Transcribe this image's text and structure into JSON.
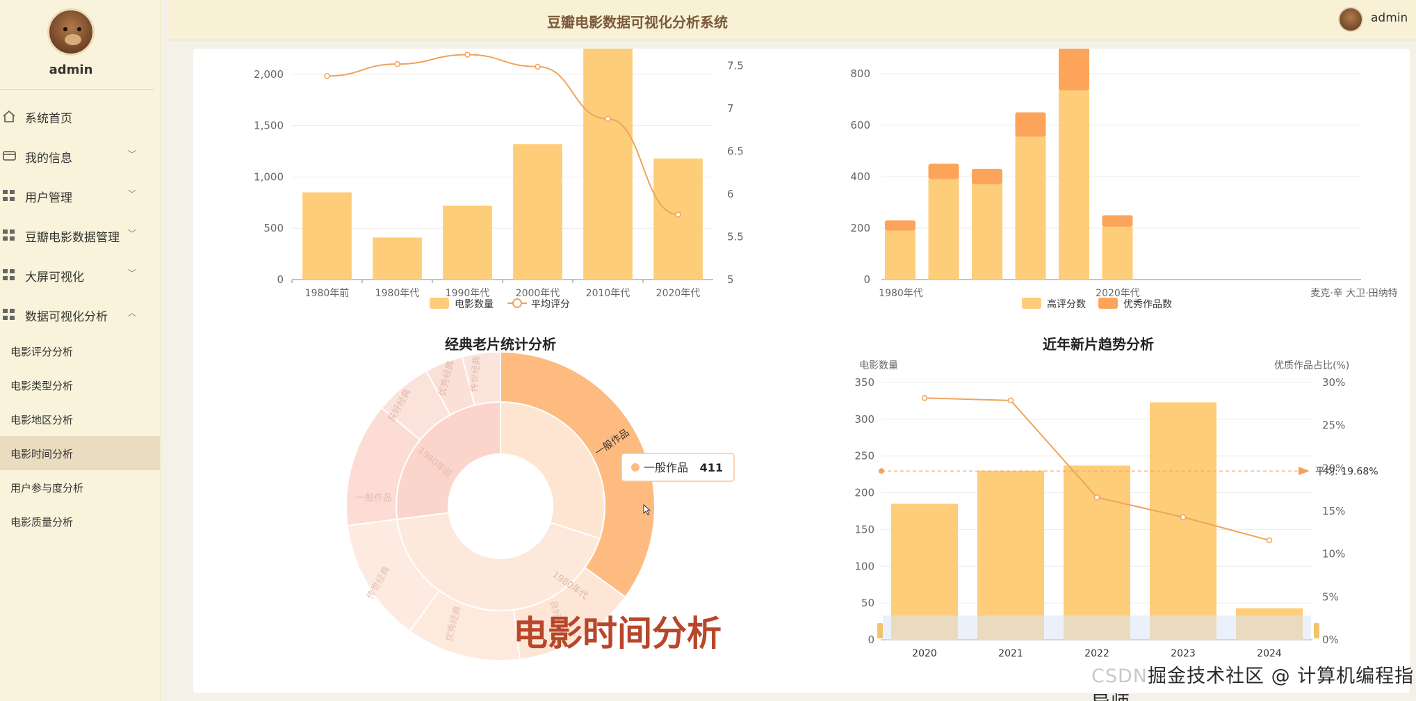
{
  "sidebar": {
    "username": "admin",
    "menu": [
      {
        "label": "系统首页",
        "icon": "home-icon",
        "caret": ""
      },
      {
        "label": "我的信息",
        "icon": "card-icon",
        "caret": "﹀"
      },
      {
        "label": "用户管理",
        "icon": "grid-icon",
        "caret": "﹀"
      },
      {
        "label": "豆瓣电影数据管理",
        "icon": "grid-icon",
        "caret": "﹀"
      },
      {
        "label": "大屏可视化",
        "icon": "grid-icon",
        "caret": "﹀"
      },
      {
        "label": "数据可视化分析",
        "icon": "grid-icon",
        "caret": "︿"
      }
    ],
    "submenu": [
      "电影评分分析",
      "电影类型分析",
      "电影地区分析",
      "电影时间分析",
      "用户参与度分析",
      "电影质量分析"
    ],
    "active_sub": "电影时间分析"
  },
  "header": {
    "title": "豆瓣电影数据可视化分析系统",
    "username": "admin"
  },
  "chart_data": [
    {
      "type": "bar",
      "categories": [
        "1980年前",
        "1980年代",
        "1990年代",
        "2000年代",
        "2010年代",
        "2020年代"
      ],
      "series": [
        {
          "name": "电影数量",
          "type": "bar",
          "values": [
            850,
            410,
            720,
            1320,
            2250,
            1180
          ]
        },
        {
          "name": "平均评分",
          "type": "line",
          "axis": "right",
          "values": [
            7.38,
            7.52,
            7.63,
            7.49,
            6.88,
            5.76
          ]
        }
      ],
      "y_left_ticks": [
        "0",
        "500",
        "1,000",
        "1,500",
        "2,000"
      ],
      "y_left_range": [
        0,
        2250
      ],
      "y_right_ticks": [
        "5",
        "5.5",
        "6",
        "6.5",
        "7",
        "7.5"
      ],
      "y_right_range": [
        5,
        7.7
      ],
      "colors": {
        "bar": "#fdcd7a",
        "line": "#f0a35a"
      }
    },
    {
      "type": "bar",
      "stacked": true,
      "categories": [
        "1980年代",
        "",
        "",
        "",
        "",
        "2020年代",
        "",
        "",
        "",
        "",
        "麦克·辛 大卫·田纳特"
      ],
      "series": [
        {
          "name": "高评分数",
          "values": [
            190,
            390,
            370,
            555,
            735,
            205
          ]
        },
        {
          "name": "优秀作品数",
          "values": [
            40,
            60,
            60,
            95,
            165,
            45
          ]
        }
      ],
      "y_ticks": [
        "0",
        "200",
        "400",
        "600",
        "800"
      ],
      "y_range": [
        0,
        900
      ],
      "colors": {
        "high": "#fdcd7a",
        "excellent": "#fca55a"
      }
    },
    {
      "type": "sunburst",
      "title": "经典老片统计分析",
      "inner": [
        {
          "label": "1980年前",
          "value": 0.27
        },
        {
          "label": "1980年代",
          "value": 0.73
        }
      ],
      "outer": [
        {
          "label": "一般作品",
          "value": 0.222
        },
        {
          "label": "良好经典",
          "value": 0.111
        },
        {
          "label": "传世经典",
          "value": 0.111
        },
        {
          "label": "优秀经典",
          "value": 0.111
        },
        {
          "label": "良好经典",
          "value": 0.111
        },
        {
          "label": "一般作品",
          "value": 0.167
        },
        {
          "label": "良好经典",
          "value": 0.055
        },
        {
          "label": "优秀经典",
          "value": 0.056
        },
        {
          "label": "传世经典",
          "value": 0.056
        }
      ],
      "tooltip": {
        "label": "一般作品",
        "value": "411"
      },
      "colors": {
        "highlight": "#fdbb80",
        "inner_main": "#fde3cc",
        "pale": "#fdeee3"
      }
    },
    {
      "type": "bar",
      "title": "近年新片趋势分析",
      "categories": [
        "2020",
        "2021",
        "2022",
        "2023",
        "2024"
      ],
      "series": [
        {
          "name": "电影数量",
          "type": "bar",
          "values": [
            185,
            230,
            237,
            323,
            43
          ]
        },
        {
          "name": "优质作品占比",
          "type": "line",
          "axis": "right",
          "values": [
            28.2,
            27.9,
            16.6,
            14.3,
            11.6
          ]
        }
      ],
      "ylabel_left": "电影数量",
      "ylabel_right": "优质作品占比(%)",
      "y_left_ticks": [
        "0",
        "50",
        "100",
        "150",
        "200",
        "250",
        "300",
        "350"
      ],
      "y_left_range": [
        0,
        350
      ],
      "y_right_ticks": [
        "0%",
        "5%",
        "10%",
        "15%",
        "20%",
        "25%",
        "30%"
      ],
      "y_right_range": [
        0,
        30
      ],
      "markline": {
        "label": "平均: 19.68%",
        "value": 19.68
      },
      "legend": [
        "电影数量",
        "优质作品占比"
      ],
      "colors": {
        "bar": "#fdcd7a",
        "line": "#f0a35a"
      }
    }
  ],
  "overlay_caption": "电影时间分析",
  "watermark": {
    "ghost": "CSDN",
    "text": "掘金技术社区 @ 计算机编程指导师",
    "ghost_tail": "@计算机编程指导师"
  }
}
